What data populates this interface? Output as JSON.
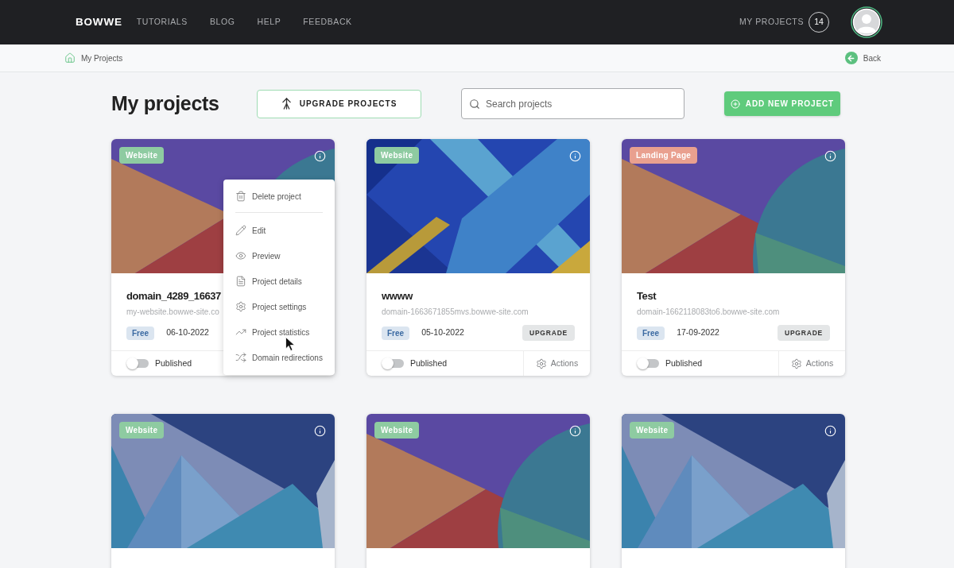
{
  "header": {
    "logo": "BOWWE",
    "nav": [
      "TUTORIALS",
      "BLOG",
      "HELP",
      "FEEDBACK"
    ],
    "projects_link": "MY PROJECTS",
    "projects_count": "14"
  },
  "breadcrumb": {
    "items": [
      "My Projects"
    ],
    "back": "Back"
  },
  "toolbar": {
    "title": "My projects",
    "upgrade_button": "UPGRADE PROJECTS",
    "search": {
      "placeholder": "Search projects"
    },
    "add_button": "ADD NEW PROJECT"
  },
  "cards": [
    {
      "badge": {
        "label": "Website",
        "color": "#8ecba1"
      },
      "kind": "geometric",
      "title": "domain_4289_16637",
      "domain": "my-website.bowwe-site.co",
      "plan": "Free",
      "date": "06-10-2022",
      "published": false,
      "published_label": "Published",
      "menu": {
        "groups": [
          [
            {
              "label": "Delete project"
            }
          ],
          [
            {
              "label": "Edit"
            },
            {
              "label": "Preview"
            },
            {
              "label": "Project details"
            },
            {
              "label": "Project settings"
            },
            {
              "label": "Project statistics"
            },
            {
              "label": "Domain redirections"
            }
          ]
        ]
      }
    },
    {
      "badge": {
        "label": "Website",
        "color": "#8ecba1"
      },
      "kind": "stripes",
      "title": "wwww",
      "domain": "domain-1663671855mvs.bowwe-site.com",
      "plan": "Free",
      "date": "05-10-2022",
      "upgrade": "UPGRADE",
      "published": false,
      "published_label": "Published",
      "actions": "Actions"
    },
    {
      "badge": {
        "label": "Landing Page",
        "color": "#e9a08f"
      },
      "kind": "geometric",
      "title": "Test",
      "domain": "domain-1662118083to6.bowwe-site.com",
      "plan": "Free",
      "date": "17-09-2022",
      "upgrade": "UPGRADE",
      "published": false,
      "published_label": "Published",
      "actions": "Actions"
    },
    {
      "badge": {
        "label": "Website",
        "color": "#8ecba1"
      },
      "kind": "mountains"
    },
    {
      "badge": {
        "label": "Website",
        "color": "#8ecba1"
      },
      "kind": "geometric"
    },
    {
      "badge": {
        "label": "Website",
        "color": "#8ecba1"
      },
      "kind": "mountains"
    }
  ]
}
